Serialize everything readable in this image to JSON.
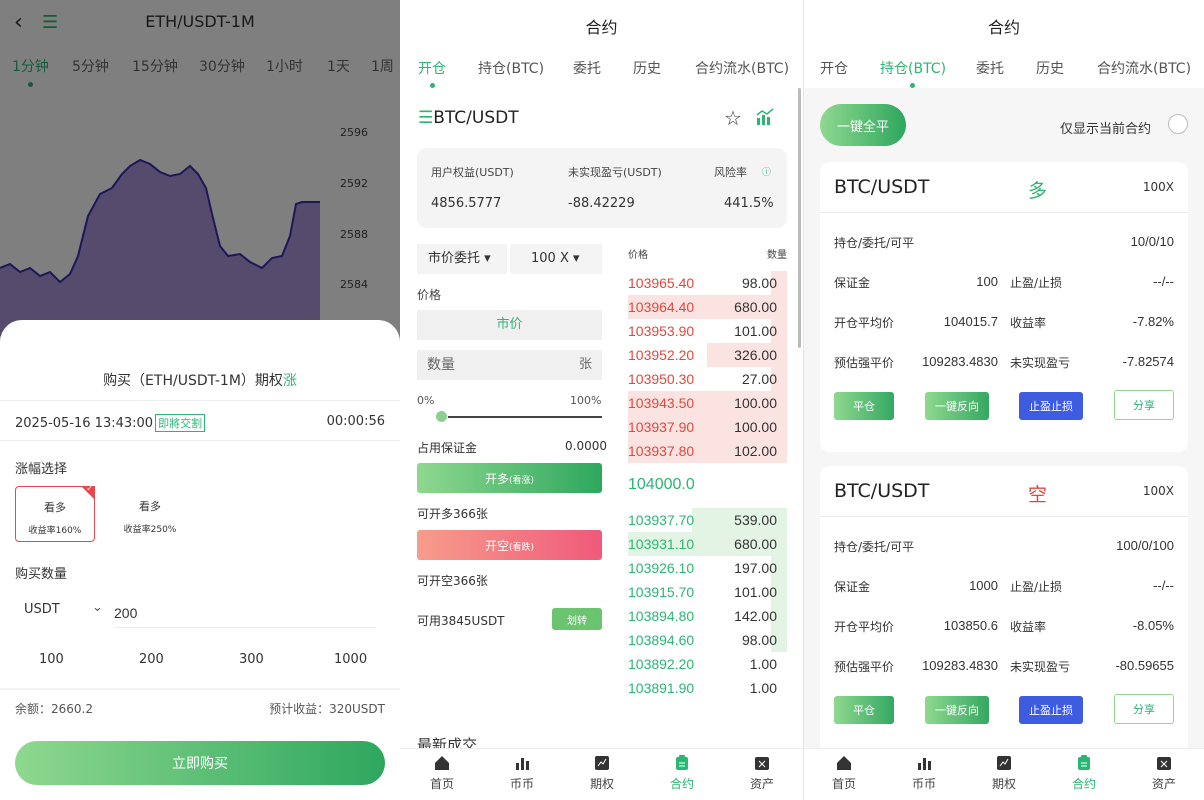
{
  "panel1": {
    "title": "ETH/USDT-1M",
    "timeframes": [
      "1分钟",
      "5分钟",
      "15分钟",
      "30分钟",
      "1小时",
      "1天",
      "1周"
    ],
    "y_ticks": [
      "2596",
      "2592",
      "2588",
      "2584"
    ],
    "sheet": {
      "title_prefix": "购买（ETH/USDT-1M）期权",
      "title_dir": "涨",
      "datetime": "2025-05-16 13:43:00",
      "settle_badge": "即將交割",
      "countdown": "00:00:56",
      "range_label": "涨幅选择",
      "options": [
        {
          "name": "看多",
          "yield": "收益率160%"
        },
        {
          "name": "看多",
          "yield": "收益率250%"
        }
      ],
      "qty_label": "购买数量",
      "unit": "USDT",
      "amount": "200",
      "quick": [
        "100",
        "200",
        "300",
        "1000"
      ],
      "balance": "余额：2660.2",
      "estimate": "预计收益：320USDT",
      "buy_label": "立即购买"
    }
  },
  "panel2": {
    "title": "合约",
    "tabs": [
      "开仓",
      "持仓(BTC)",
      "委托",
      "历史",
      "合约流水(BTC)"
    ],
    "symbol": "BTC/USDT",
    "stats": {
      "equity_label": "用户权益(USDT)",
      "equity": "4856.5777",
      "pnl_label": "未实现盈亏(USDT)",
      "pnl": "-88.42229",
      "risk_label": "风险率",
      "risk": "441.5%"
    },
    "order_type": "市价委托",
    "leverage": "100 X",
    "price_label": "价格",
    "market": "市价",
    "qty_placeholder": "数量",
    "qty_unit": "张",
    "pct_min": "0%",
    "pct_max": "100%",
    "margin_label": "占用保证金",
    "margin_value": "0.0000",
    "long_label": "开多",
    "long_sub": "(看涨)",
    "can_long": "可开多366张",
    "short_label": "开空",
    "short_sub": "(看跌)",
    "can_short": "可开空366张",
    "available": "可用3845USDT",
    "transfer": "划转",
    "ob_price_h": "价格",
    "ob_qty_h": "数量",
    "asks": [
      {
        "p": "103965.40",
        "q": "98.00",
        "d": 0.1
      },
      {
        "p": "103964.40",
        "q": "680.00",
        "d": 1.0
      },
      {
        "p": "103953.90",
        "q": "101.00",
        "d": 0.1
      },
      {
        "p": "103952.20",
        "q": "326.00",
        "d": 0.5
      },
      {
        "p": "103950.30",
        "q": "27.00",
        "d": 0.1
      },
      {
        "p": "103943.50",
        "q": "100.00",
        "d": 1.0
      },
      {
        "p": "103937.90",
        "q": "100.00",
        "d": 1.0
      },
      {
        "p": "103937.80",
        "q": "102.00",
        "d": 1.0
      }
    ],
    "last": "104000.0",
    "bids": [
      {
        "p": "103937.70",
        "q": "539.00",
        "d": 0.6
      },
      {
        "p": "103931.10",
        "q": "680.00",
        "d": 1.0
      },
      {
        "p": "103926.10",
        "q": "197.00",
        "d": 0.1
      },
      {
        "p": "103915.70",
        "q": "101.00",
        "d": 0.1
      },
      {
        "p": "103894.80",
        "q": "142.00",
        "d": 0.1
      },
      {
        "p": "103894.60",
        "q": "98.00",
        "d": 0.1
      },
      {
        "p": "103892.20",
        "q": "1.00",
        "d": 0.0
      },
      {
        "p": "103891.90",
        "q": "1.00",
        "d": 0.0
      }
    ],
    "latest_trades": "最新成交"
  },
  "panel3": {
    "title": "合约",
    "tabs": [
      "开仓",
      "持仓(BTC)",
      "委托",
      "历史",
      "合约流水(BTC)"
    ],
    "close_all": "一键全平",
    "only_current": "仅显示当前合约",
    "labels": {
      "hold": "持仓/委托/可平",
      "margin": "保证金",
      "tpsl": "止盈/止损",
      "avg": "开仓平均价",
      "yield": "收益率",
      "liq": "预估强平价",
      "upnl": "未实现盈亏"
    },
    "buttons": {
      "close": "平仓",
      "reverse": "一键反向",
      "tpsl": "止盈止损",
      "share": "分享"
    },
    "positions": [
      {
        "symbol": "BTC/USDT",
        "side": "多",
        "side_color": "#2bb673",
        "lev": "100X",
        "hold": "10/0/10",
        "margin": "100",
        "tpsl": "--/--",
        "avg": "104015.7",
        "yield": "-7.82%",
        "liq": "109283.4830",
        "upnl": "-7.82574"
      },
      {
        "symbol": "BTC/USDT",
        "side": "空",
        "side_color": "#e0483e",
        "lev": "100X",
        "hold": "100/0/100",
        "margin": "1000",
        "tpsl": "--/--",
        "avg": "103850.6",
        "yield": "-8.05%",
        "liq": "109283.4830",
        "upnl": "-80.59655"
      }
    ]
  },
  "nav": [
    "首页",
    "币币",
    "期权",
    "合约",
    "资产"
  ],
  "colors": {
    "green": "#2bb673",
    "red": "#e0483e",
    "blue": "#3d5ce0"
  }
}
